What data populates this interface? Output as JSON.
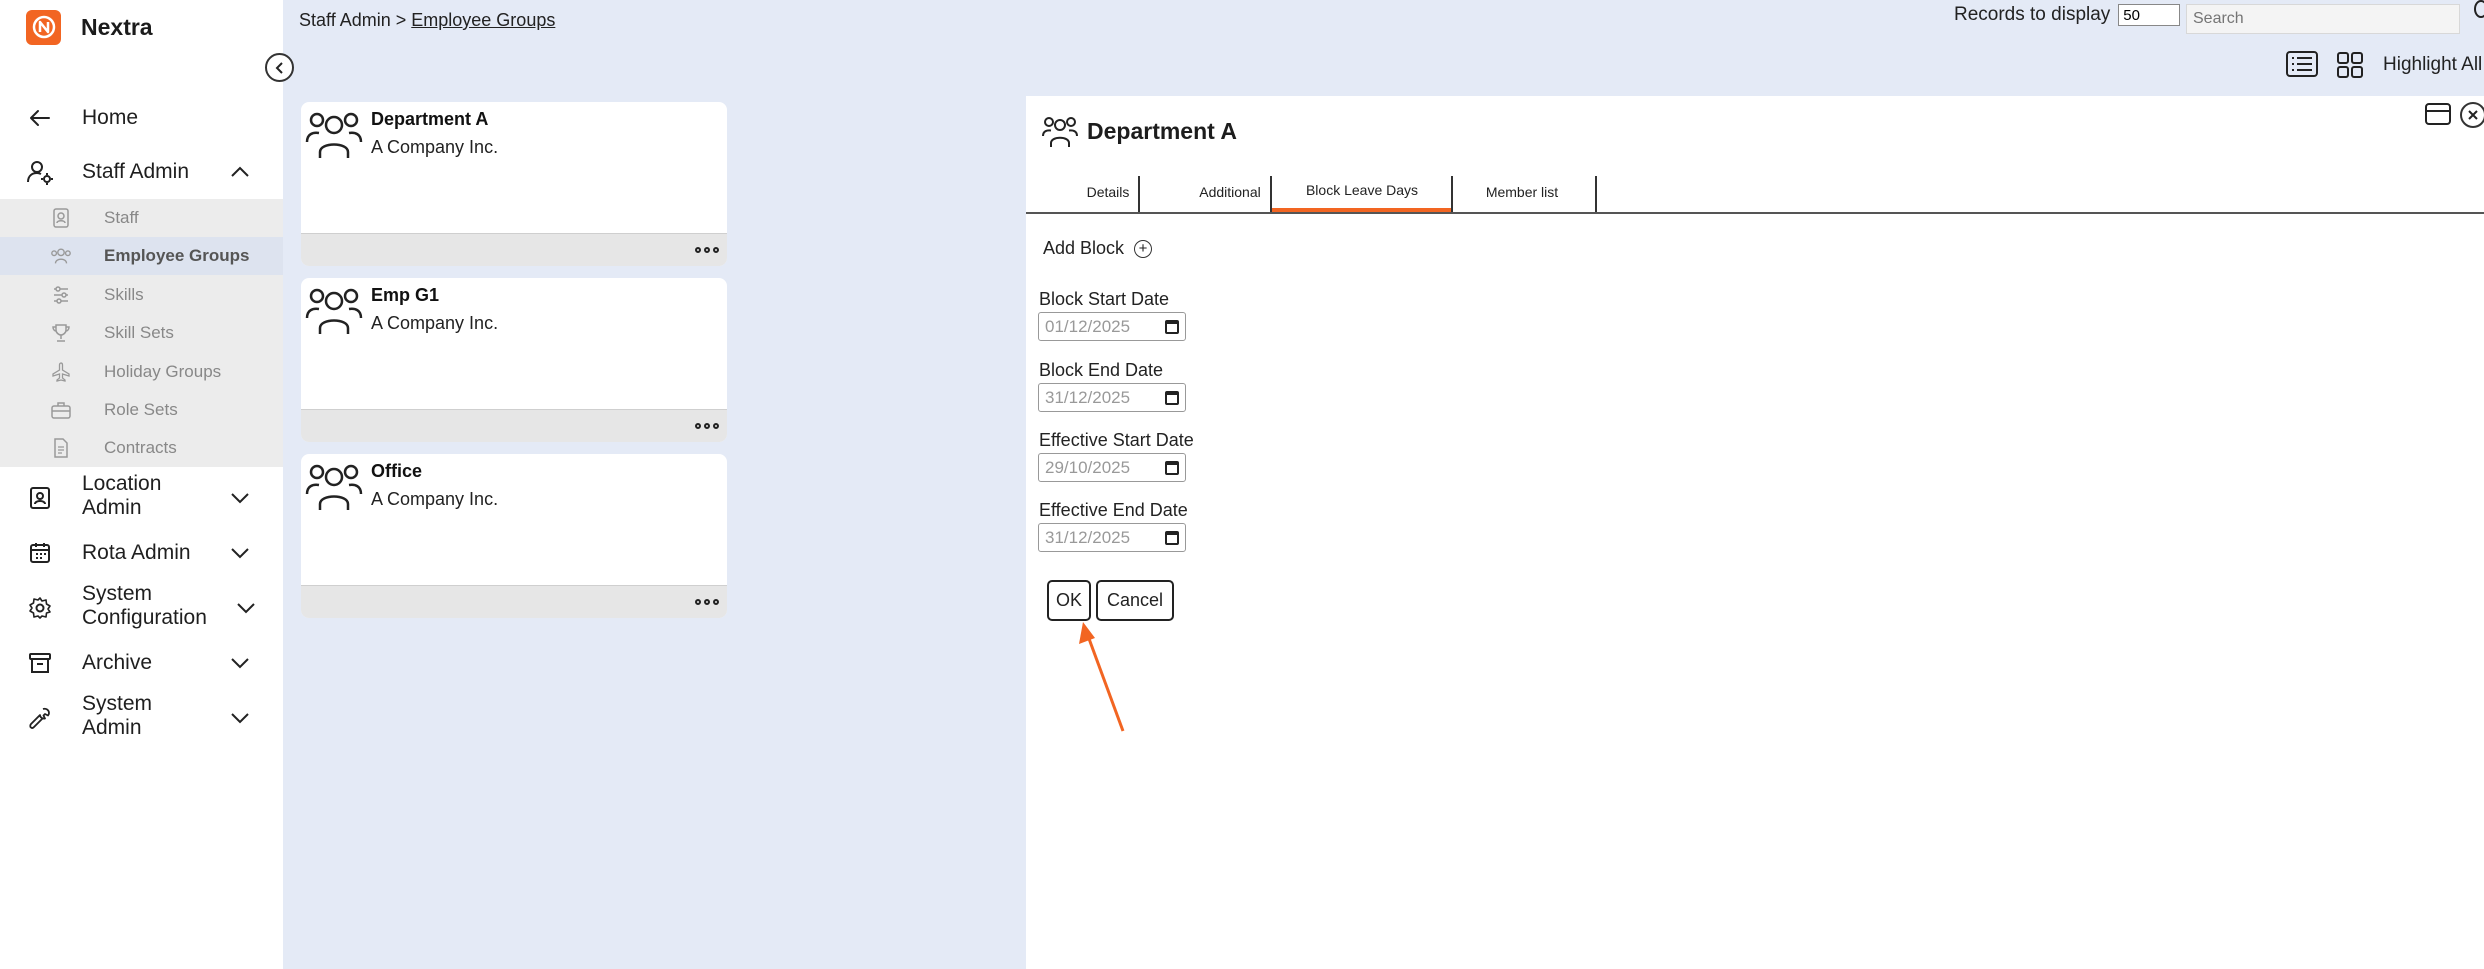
{
  "app": {
    "brand_name": "Nextra",
    "brand_color": "#f26522"
  },
  "sidebar": {
    "home_label": "Home",
    "staff_admin_label": "Staff Admin",
    "staff_admin_items": [
      {
        "label": "Staff",
        "icon": "id-badge-icon"
      },
      {
        "label": "Employee Groups",
        "icon": "people-icon"
      },
      {
        "label": "Skills",
        "icon": "skills-icon"
      },
      {
        "label": "Skill Sets",
        "icon": "trophy-icon"
      },
      {
        "label": "Holiday Groups",
        "icon": "plane-icon"
      },
      {
        "label": "Role Sets",
        "icon": "briefcase-icon"
      },
      {
        "label": "Contracts",
        "icon": "document-icon"
      }
    ],
    "sections": [
      {
        "label_line1": "Location",
        "label_line2": "Admin"
      },
      {
        "label_line1": "Rota Admin",
        "label_line2": ""
      },
      {
        "label_line1": "System",
        "label_line2": "Configuration"
      },
      {
        "label_line1": "Archive",
        "label_line2": ""
      },
      {
        "label_line1": "System",
        "label_line2": "Admin"
      }
    ]
  },
  "header": {
    "breadcrumb_root": "Staff Admin >",
    "breadcrumb_current": "Employee Groups",
    "records_label": "Records to display",
    "records_value": "50",
    "search_placeholder": "Search",
    "highlight_all_label": "Highlight All"
  },
  "cards": [
    {
      "title": "Department A",
      "subtitle": "A Company Inc."
    },
    {
      "title": "Emp G1",
      "subtitle": "A Company Inc."
    },
    {
      "title": "Office",
      "subtitle": "A Company Inc."
    }
  ],
  "panel": {
    "title": "Department A",
    "tabs": [
      "Details",
      "Additional",
      "Block Leave Days",
      "Member list"
    ],
    "active_tab": "Block Leave Days",
    "add_block_label": "Add Block",
    "fields": [
      {
        "label": "Block Start Date",
        "value": "01/12/2025"
      },
      {
        "label": "Block End Date",
        "value": "31/12/2025"
      },
      {
        "label": "Effective Start Date",
        "value": "29/10/2025"
      },
      {
        "label": "Effective End Date",
        "value": "31/12/2025"
      }
    ],
    "ok_label": "OK",
    "cancel_label": "Cancel"
  },
  "annotation": {
    "arrow_color": "#f26522"
  }
}
